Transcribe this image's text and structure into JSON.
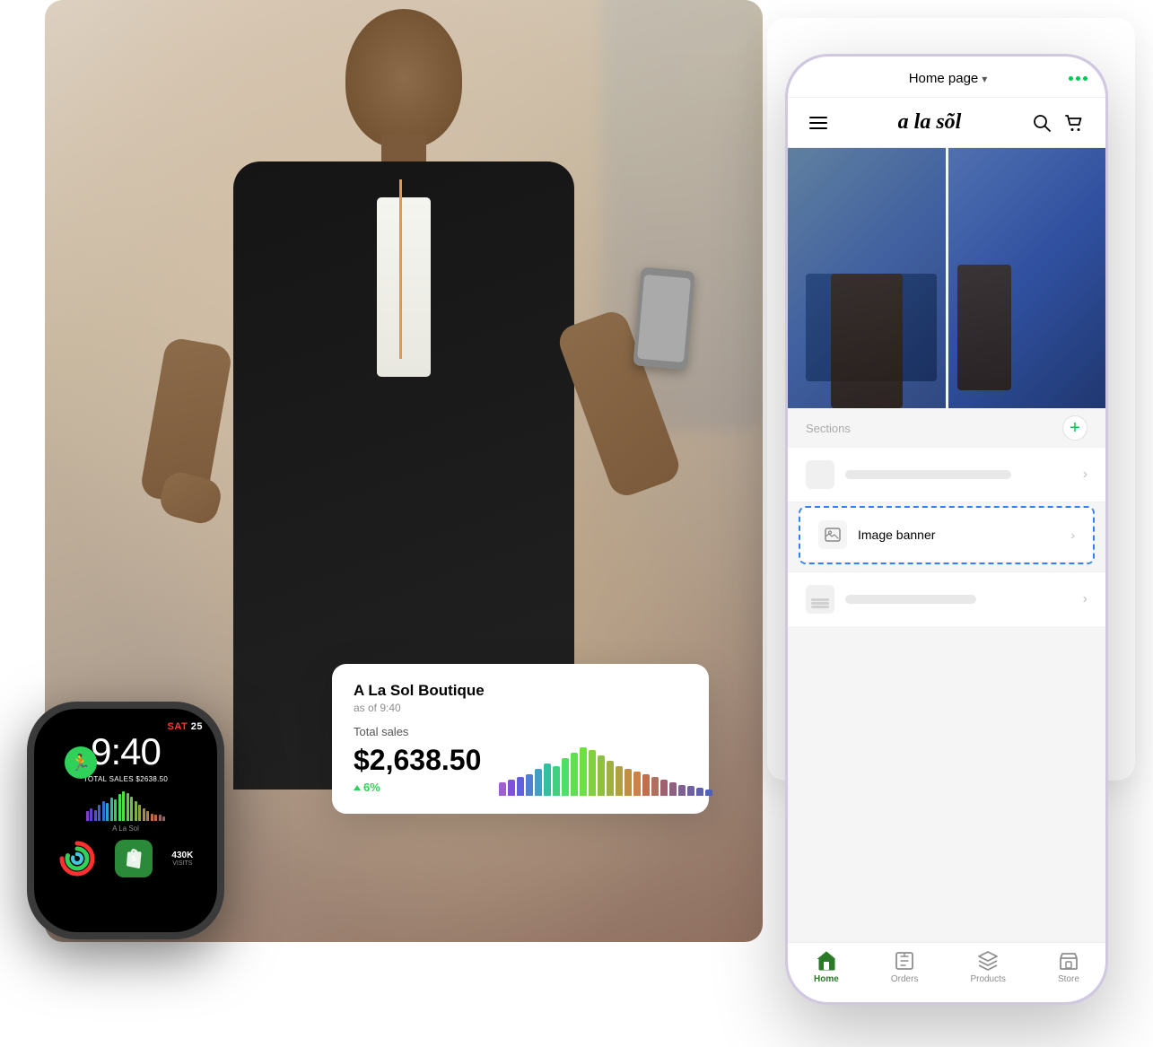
{
  "photo": {
    "alt": "Woman smiling and looking at phone"
  },
  "watch": {
    "day": "SAT",
    "date": "25",
    "time": "9:40",
    "total_sales_label": "TOTAL SALES",
    "total_sales_value": "$2638.50",
    "store_name": "A La Sol",
    "visits_value": "430K",
    "visits_label": "VISITS",
    "bars": [
      {
        "height": 0.3,
        "color": "#8040c0"
      },
      {
        "height": 0.4,
        "color": "#6040d0"
      },
      {
        "height": 0.35,
        "color": "#5050e0"
      },
      {
        "height": 0.5,
        "color": "#4060d0"
      },
      {
        "height": 0.6,
        "color": "#3070d0"
      },
      {
        "height": 0.55,
        "color": "#30a0d0"
      },
      {
        "height": 0.7,
        "color": "#20c0a0"
      },
      {
        "height": 0.65,
        "color": "#30d060"
      },
      {
        "height": 0.8,
        "color": "#40e050"
      },
      {
        "height": 0.9,
        "color": "#50e040"
      },
      {
        "height": 0.85,
        "color": "#60d040"
      },
      {
        "height": 0.75,
        "color": "#70c040"
      },
      {
        "height": 0.6,
        "color": "#80b040"
      },
      {
        "height": 0.5,
        "color": "#90a040"
      },
      {
        "height": 0.4,
        "color": "#a09040"
      },
      {
        "height": 0.3,
        "color": "#b08040"
      },
      {
        "height": 0.25,
        "color": "#c07040"
      },
      {
        "height": 0.2,
        "color": "#b07050"
      },
      {
        "height": 0.2,
        "color": "#a06060"
      },
      {
        "height": 0.15,
        "color": "#906070"
      }
    ]
  },
  "sales_card": {
    "store_name": "A La Sol Boutique",
    "as_of": "as of 9:40",
    "total_sales_label": "Total sales",
    "amount": "$2,638.50",
    "percent": "6%",
    "bars": [
      {
        "height": 0.25,
        "color": "#a060d0"
      },
      {
        "height": 0.3,
        "color": "#8050e0"
      },
      {
        "height": 0.35,
        "color": "#6060e0"
      },
      {
        "height": 0.4,
        "color": "#5080d0"
      },
      {
        "height": 0.5,
        "color": "#40a0c0"
      },
      {
        "height": 0.6,
        "color": "#30c0a0"
      },
      {
        "height": 0.55,
        "color": "#40d080"
      },
      {
        "height": 0.7,
        "color": "#50e060"
      },
      {
        "height": 0.8,
        "color": "#60e050"
      },
      {
        "height": 0.9,
        "color": "#70e040"
      },
      {
        "height": 0.85,
        "color": "#80d040"
      },
      {
        "height": 0.75,
        "color": "#90c040"
      },
      {
        "height": 0.65,
        "color": "#a0b040"
      },
      {
        "height": 0.55,
        "color": "#b0a040"
      },
      {
        "height": 0.5,
        "color": "#c09040"
      },
      {
        "height": 0.45,
        "color": "#d08040"
      },
      {
        "height": 0.4,
        "color": "#c07050"
      },
      {
        "height": 0.35,
        "color": "#b07060"
      },
      {
        "height": 0.3,
        "color": "#a06070"
      },
      {
        "height": 0.25,
        "color": "#906080"
      },
      {
        "height": 0.2,
        "color": "#806090"
      },
      {
        "height": 0.18,
        "color": "#7060a0"
      },
      {
        "height": 0.15,
        "color": "#6060b0"
      },
      {
        "height": 0.12,
        "color": "#5060c0"
      }
    ]
  },
  "phone": {
    "header": {
      "page_title": "Home page",
      "dropdown_icon": "▾",
      "more_label": "···"
    },
    "store": {
      "logo": "a la sõl"
    },
    "sections": {
      "label": "Sections"
    },
    "add_button": "+",
    "list_items": [
      {
        "label": "Image banner",
        "icon": "🖼"
      },
      {
        "label": "",
        "icon": "≡"
      }
    ],
    "nav": [
      {
        "icon": "🏠",
        "label": "Home",
        "active": true
      },
      {
        "icon": "📥",
        "label": "Orders",
        "active": false
      },
      {
        "icon": "🏷",
        "label": "Products",
        "active": false
      },
      {
        "icon": "🏪",
        "label": "Store",
        "active": false
      }
    ]
  }
}
